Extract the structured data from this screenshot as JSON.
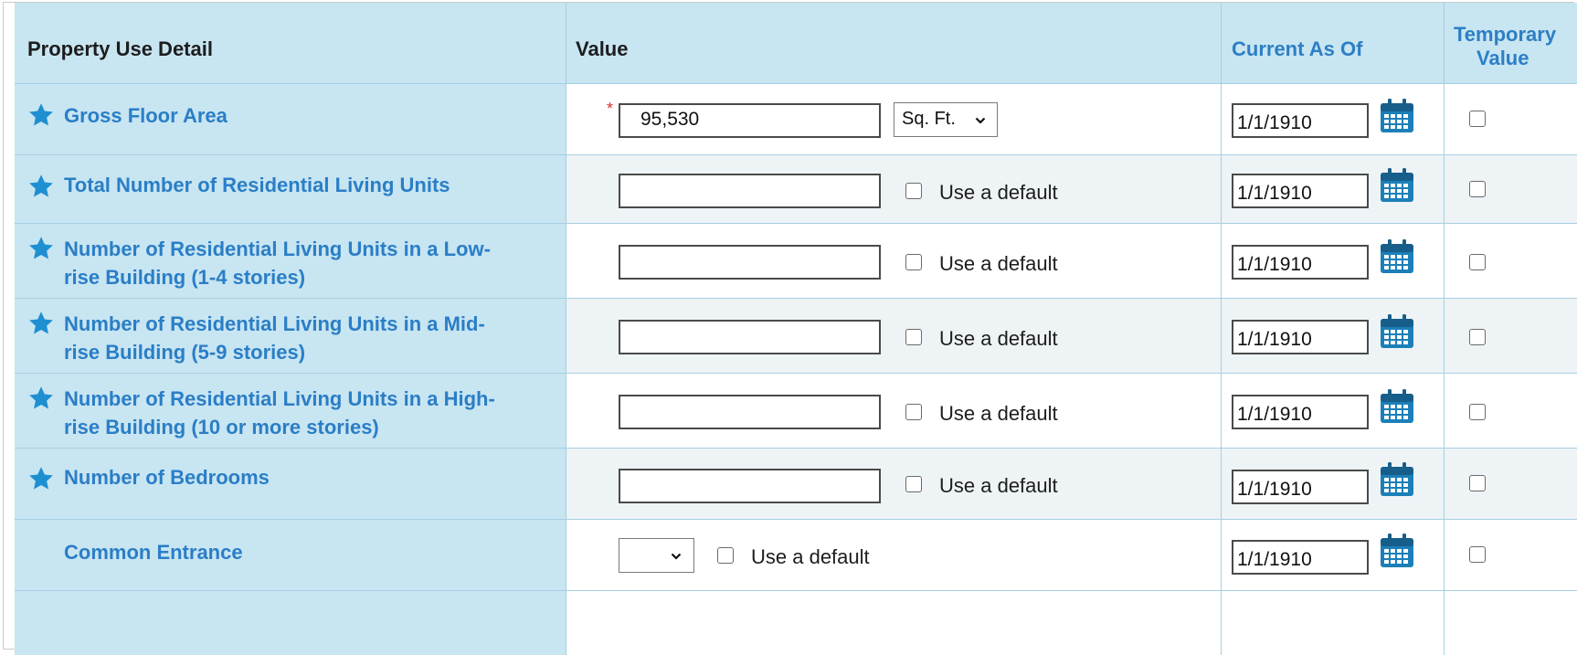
{
  "header": {
    "col_detail": "Property Use Detail",
    "col_value": "Value",
    "col_current": "Current As Of",
    "col_temp_line1": "Temporary",
    "col_temp_line2": "Value"
  },
  "rows": [
    {
      "label_lines": [
        "Gross Floor Area"
      ],
      "starred": true,
      "value": "95,530",
      "required": true,
      "unit": "Sq. Ft.",
      "date": "1/1/1910"
    },
    {
      "label_lines": [
        "Total Number of Residential Living Units"
      ],
      "starred": true,
      "value": "",
      "default_label": "Use a default",
      "date": "1/1/1910"
    },
    {
      "label_lines": [
        "Number of Residential Living Units in a Low-",
        "rise Building (1-4 stories)"
      ],
      "starred": true,
      "value": "",
      "default_label": "Use a default",
      "date": "1/1/1910"
    },
    {
      "label_lines": [
        "Number of Residential Living Units in a Mid-",
        "rise Building (5-9 stories)"
      ],
      "starred": true,
      "value": "",
      "default_label": "Use a default",
      "date": "1/1/1910"
    },
    {
      "label_lines": [
        "Number of Residential Living Units in a High-",
        "rise Building (10 or more stories)"
      ],
      "starred": true,
      "value": "",
      "default_label": "Use a default",
      "date": "1/1/1910"
    },
    {
      "label_lines": [
        "Number of Bedrooms"
      ],
      "starred": true,
      "value": "",
      "default_label": "Use a default",
      "date": "1/1/1910"
    },
    {
      "label_lines": [
        "Common Entrance"
      ],
      "starred": false,
      "select_value": "",
      "default_label": "Use a default",
      "date": "1/1/1910"
    }
  ],
  "icons": {
    "star": "star-icon",
    "calendar": "calendar-icon",
    "chevron": "chevron-down-icon"
  },
  "colors": {
    "label_bg": "#c8e5f2",
    "link_blue": "#2a7ec6",
    "star_blue": "#1e8fd0",
    "alt_row_bg": "#eef3f6",
    "required_red": "#d9302b"
  }
}
